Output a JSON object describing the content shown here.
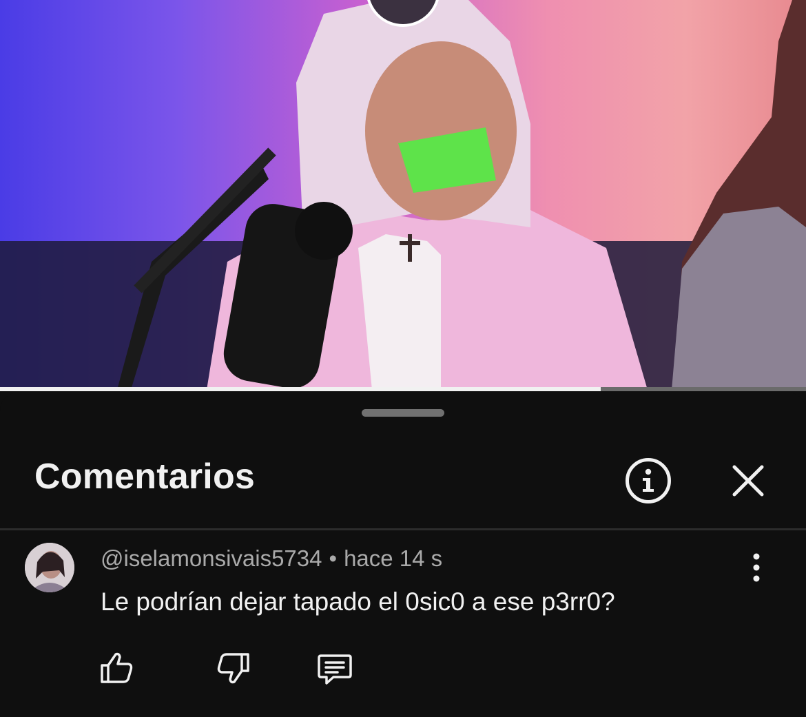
{
  "video": {
    "progress_fraction": 0.745
  },
  "sheet": {
    "title": "Comentarios",
    "info_icon": "info-circle-icon",
    "close_icon": "close-icon"
  },
  "comment": {
    "author": "@iselamonsivais5734",
    "separator": "•",
    "time": "hace 14 s",
    "text": "Le podrían dejar tapado el 0sic0 a ese p3rr0?",
    "actions": [
      "like-icon",
      "dislike-icon",
      "reply-icon"
    ],
    "more_icon": "more-vertical-icon"
  },
  "colors": {
    "background": "#0f0f0f",
    "text_primary": "#f1f1f1",
    "text_secondary": "#aaaaaa",
    "tape_green": "#5ee34a"
  }
}
